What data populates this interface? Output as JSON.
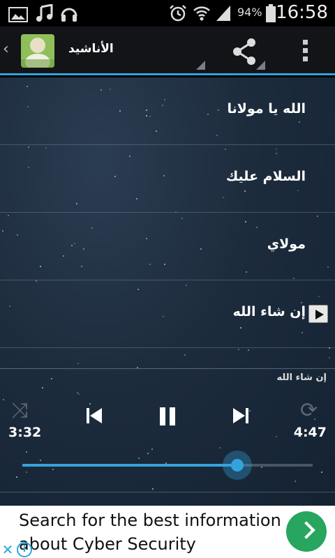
{
  "status_bar": {
    "battery_percent": "94%",
    "time": "16:58",
    "icons": [
      "image-icon",
      "music-note-icon",
      "headphones-icon",
      "alarm-icon",
      "wifi-icon",
      "signal-icon",
      "battery-icon"
    ]
  },
  "action_bar": {
    "title": "الأناشيد",
    "accent_color": "#33a3dc",
    "icons": [
      "back-caret-icon",
      "app-icon",
      "share-icon",
      "overflow-menu-icon"
    ]
  },
  "songs": [
    {
      "title": "الله يا مولانا",
      "playing": false
    },
    {
      "title": "السلام عليك",
      "playing": false
    },
    {
      "title": "مولاي",
      "playing": false
    },
    {
      "title": "إن شاء الله",
      "playing": true
    }
  ],
  "player": {
    "now_playing": "إن شاء الله",
    "elapsed": "3:32",
    "duration": "4:47",
    "progress_fraction": 0.74,
    "icons": [
      "shuffle-icon",
      "previous-icon",
      "pause-icon",
      "next-icon",
      "repeat-icon"
    ]
  },
  "ad": {
    "text": "Search for the best information about Cyber Security",
    "button_color": "#28a55f",
    "icons": [
      "ad-close-icon",
      "ad-info-icon",
      "chevron-right-icon"
    ]
  }
}
